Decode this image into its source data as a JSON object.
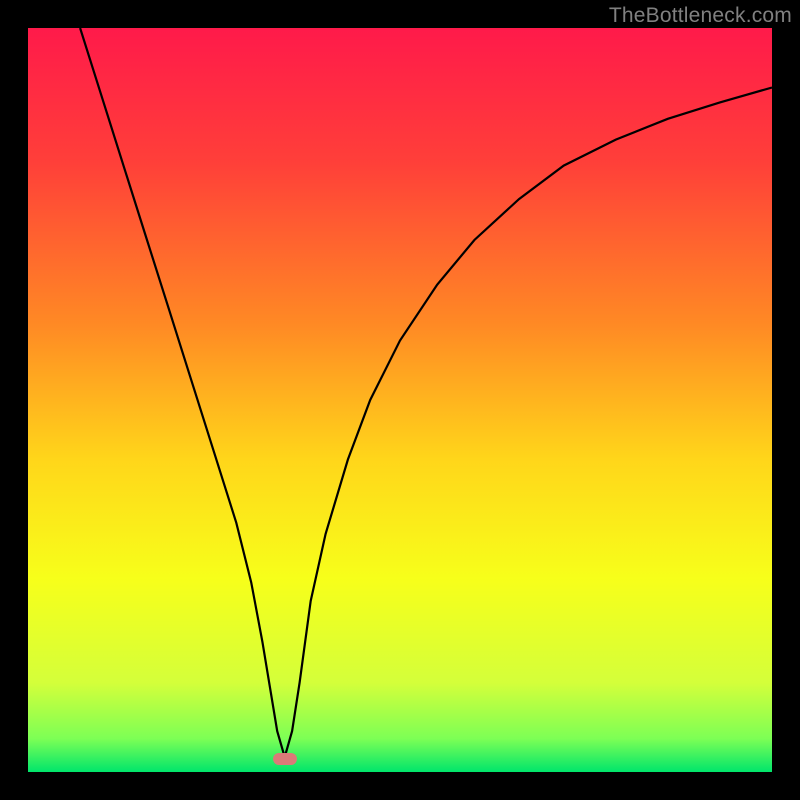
{
  "watermark": "TheBottleneck.com",
  "chart_data": {
    "type": "line",
    "title": "",
    "xlabel": "",
    "ylabel": "",
    "xlim": [
      0,
      1
    ],
    "ylim": [
      0,
      1
    ],
    "gradient_stops": [
      {
        "offset": 0.0,
        "color": "#ff1a4a"
      },
      {
        "offset": 0.18,
        "color": "#ff3f39"
      },
      {
        "offset": 0.4,
        "color": "#ff8a24"
      },
      {
        "offset": 0.58,
        "color": "#ffd61a"
      },
      {
        "offset": 0.74,
        "color": "#f7ff1a"
      },
      {
        "offset": 0.88,
        "color": "#d4ff3a"
      },
      {
        "offset": 0.955,
        "color": "#7dff55"
      },
      {
        "offset": 1.0,
        "color": "#00e56b"
      }
    ],
    "series": [
      {
        "name": "curve",
        "x": [
          0.07,
          0.1,
          0.13,
          0.16,
          0.19,
          0.22,
          0.25,
          0.28,
          0.3,
          0.315,
          0.325,
          0.335,
          0.345,
          0.355,
          0.365,
          0.38,
          0.4,
          0.43,
          0.46,
          0.5,
          0.55,
          0.6,
          0.66,
          0.72,
          0.79,
          0.86,
          0.93,
          1.0
        ],
        "y": [
          1.0,
          0.905,
          0.81,
          0.715,
          0.62,
          0.525,
          0.43,
          0.335,
          0.255,
          0.175,
          0.115,
          0.055,
          0.02,
          0.055,
          0.12,
          0.23,
          0.32,
          0.42,
          0.5,
          0.58,
          0.655,
          0.715,
          0.77,
          0.815,
          0.85,
          0.878,
          0.9,
          0.92
        ]
      }
    ],
    "marker": {
      "x": 0.345,
      "y": 0.018,
      "color": "#db7a78"
    }
  }
}
